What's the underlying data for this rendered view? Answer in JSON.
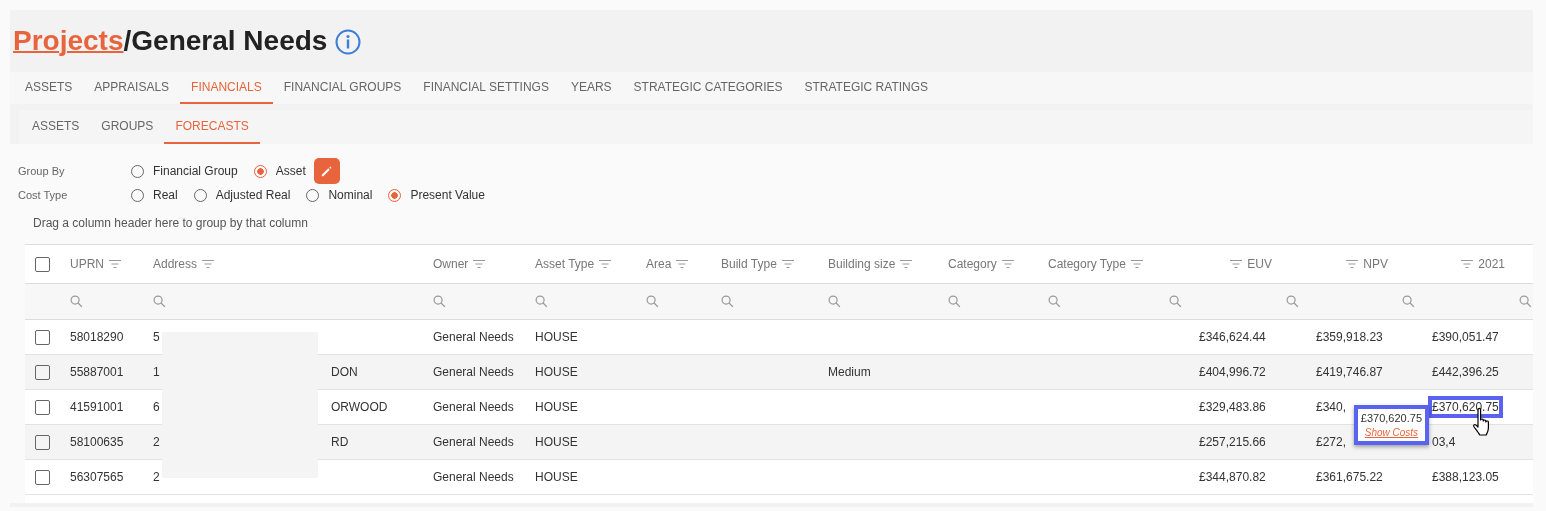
{
  "title": {
    "link": "Projects",
    "separator": "/",
    "text": "General Needs"
  },
  "tabs": [
    {
      "label": "ASSETS",
      "selected": false
    },
    {
      "label": "APPRAISALS",
      "selected": false
    },
    {
      "label": "FINANCIALS",
      "selected": true
    },
    {
      "label": "FINANCIAL GROUPS",
      "selected": false
    },
    {
      "label": "FINANCIAL SETTINGS",
      "selected": false
    },
    {
      "label": "YEARS",
      "selected": false
    },
    {
      "label": "STRATEGIC CATEGORIES",
      "selected": false
    },
    {
      "label": "STRATEGIC RATINGS",
      "selected": false
    }
  ],
  "subtabs": [
    {
      "label": "ASSETS",
      "selected": false
    },
    {
      "label": "GROUPS",
      "selected": false
    },
    {
      "label": "FORECASTS",
      "selected": true
    }
  ],
  "options": [
    {
      "label": "Group By",
      "edit_button": true,
      "choices": [
        {
          "label": "Financial Group",
          "selected": false
        },
        {
          "label": "Asset",
          "selected": true
        }
      ]
    },
    {
      "label": "Cost Type",
      "choices": [
        {
          "label": "Real",
          "selected": false
        },
        {
          "label": "Adjusted Real",
          "selected": false
        },
        {
          "label": "Nominal",
          "selected": false
        },
        {
          "label": "Present Value",
          "selected": true
        }
      ]
    }
  ],
  "group_hint": "Drag a column header here to group by that column",
  "table": {
    "header_checked": false,
    "columns": [
      {
        "label": "UPRN",
        "kind": "text"
      },
      {
        "label": "Address",
        "kind": "address"
      },
      {
        "label": "Owner",
        "kind": "text"
      },
      {
        "label": "Asset Type",
        "kind": "text"
      },
      {
        "label": "Area",
        "kind": "text"
      },
      {
        "label": "Build Type",
        "kind": "text"
      },
      {
        "label": "Building size",
        "kind": "text"
      },
      {
        "label": "Category",
        "kind": "text"
      },
      {
        "label": "Category Type",
        "kind": "text"
      },
      {
        "label": "EUV",
        "kind": "money"
      },
      {
        "label": "NPV",
        "kind": "money"
      },
      {
        "label": "2021",
        "kind": "money"
      }
    ],
    "rows": [
      {
        "checked": false,
        "cells": [
          "58018290",
          [
            "5"
          ],
          "General Needs",
          "HOUSE",
          null,
          null,
          null,
          null,
          null,
          "£346,624.44",
          "£359,918.23",
          "£390,051.47"
        ]
      },
      {
        "checked": false,
        "cells": [
          "55887001",
          [
            "1",
            "DON"
          ],
          "General Needs",
          "HOUSE",
          null,
          null,
          "Medium",
          null,
          null,
          "£404,996.72",
          "£419,746.87",
          "£442,396.25"
        ]
      },
      {
        "checked": false,
        "cells": [
          "41591001",
          [
            "6",
            "ORWOOD"
          ],
          "General Needs",
          "HOUSE",
          null,
          null,
          null,
          null,
          null,
          "£329,483.86",
          "£340,",
          "£370,620.75"
        ],
        "tooltip": {
          "value": "£370,620.75",
          "link": "Show Costs"
        }
      },
      {
        "checked": false,
        "cells": [
          "58100635",
          [
            "2",
            "RD"
          ],
          "General Needs",
          "HOUSE",
          null,
          null,
          null,
          null,
          null,
          "£257,215.66",
          "£272,",
          "03,4"
        ]
      },
      {
        "checked": false,
        "cells": [
          "56307565",
          [
            "2"
          ],
          "General Needs",
          "HOUSE",
          null,
          null,
          null,
          null,
          null,
          "£344,870.82",
          "£361,675.22",
          "£388,123.05"
        ]
      }
    ]
  }
}
